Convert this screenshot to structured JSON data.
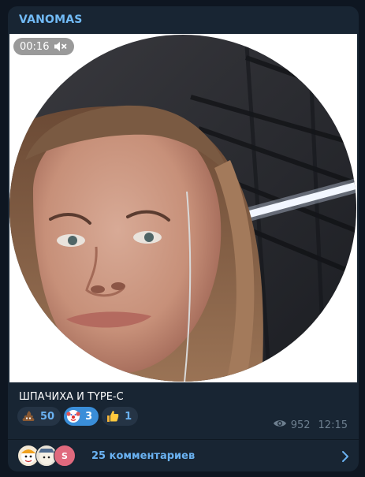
{
  "channel": {
    "name": "VANOMAS"
  },
  "video": {
    "duration": "00:16"
  },
  "post": {
    "caption": "ШПАЧИХА И TYPE-C",
    "views": "952",
    "time": "12:15"
  },
  "reactions": [
    {
      "emoji": "poop",
      "count": "50",
      "active": false
    },
    {
      "emoji": "clown",
      "count": "3",
      "active": true
    },
    {
      "emoji": "thumbs-up",
      "count": "1",
      "active": false
    }
  ],
  "comments": {
    "label": "25 комментариев",
    "avatars": [
      "avatar-1",
      "avatar-2",
      "S"
    ]
  },
  "colors": {
    "background": "#0e1621",
    "card": "#182533",
    "accent": "#6ab2f2",
    "channel_name": "#71baf5"
  }
}
